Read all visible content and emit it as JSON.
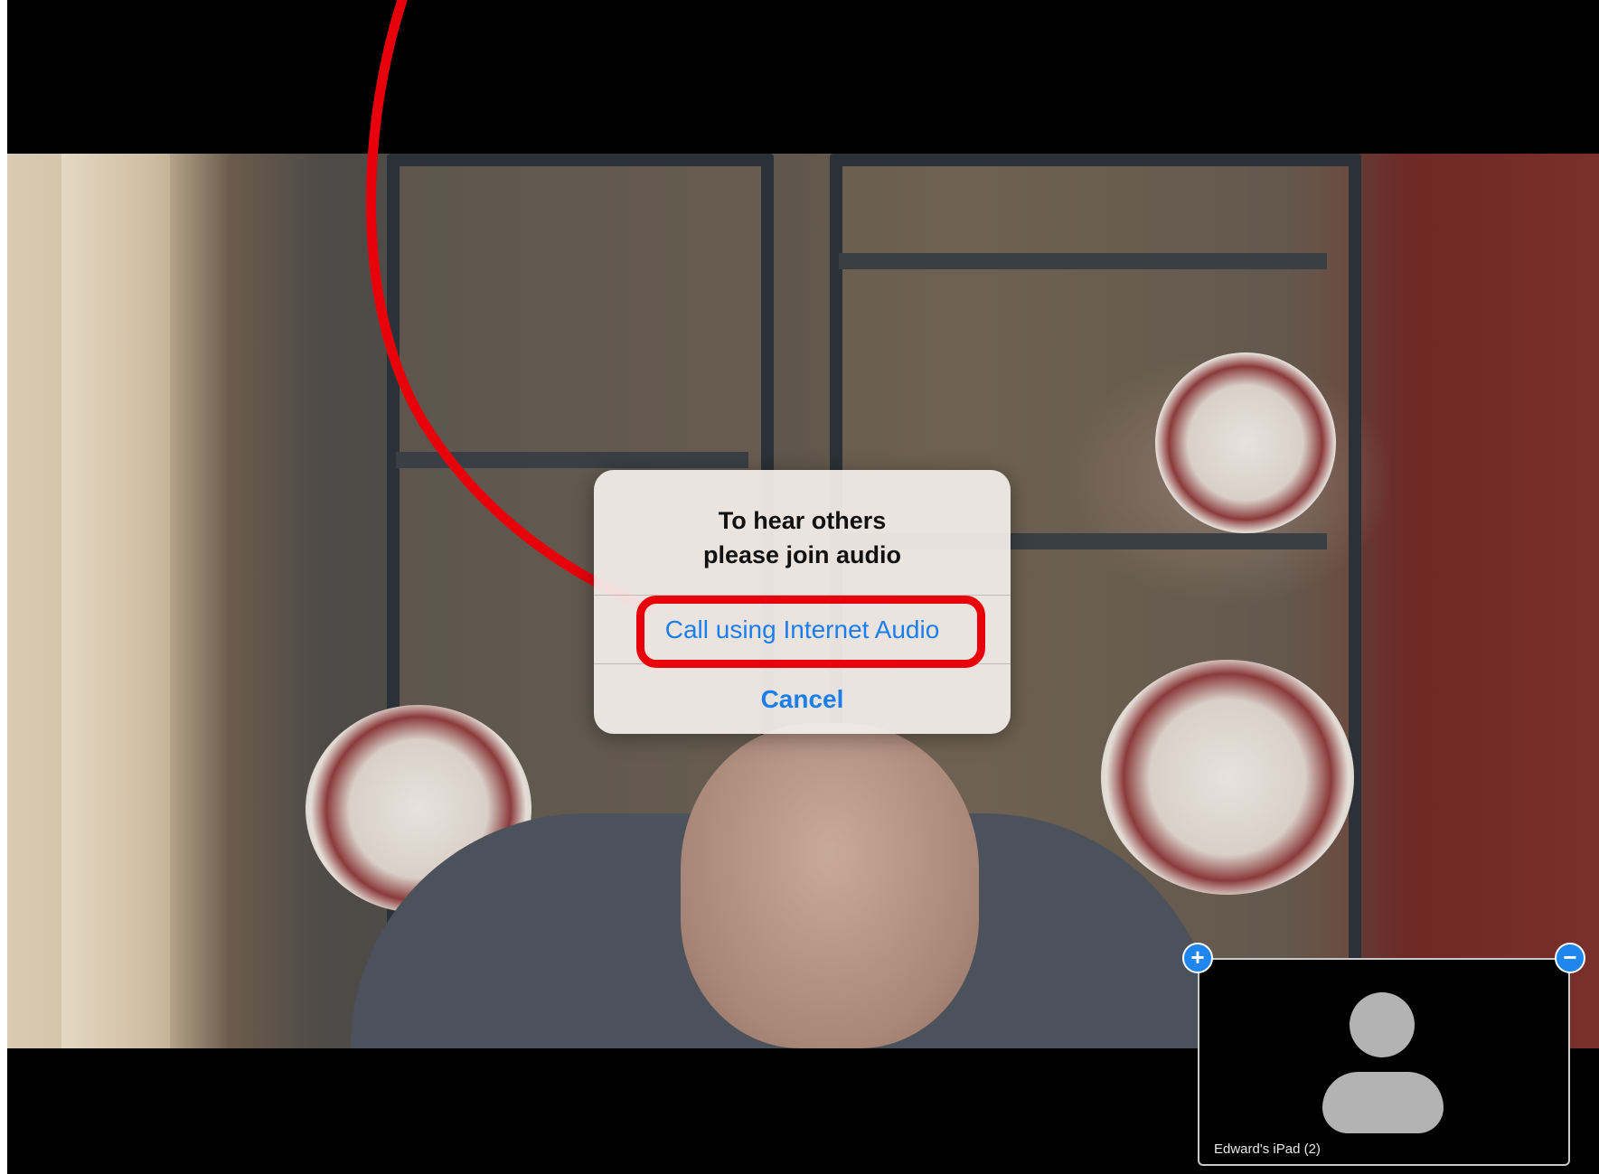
{
  "alert": {
    "message": "To hear others\nplease join audio",
    "primary_button": "Call using Internet Audio",
    "cancel_button": "Cancel"
  },
  "thumbnail": {
    "label": "Edward's iPad (2)",
    "expand_icon": "plus-icon",
    "collapse_icon": "minus-icon"
  },
  "colors": {
    "alert_link": "#1a7ef0",
    "annotation": "#e8000b",
    "thumbnail_control": "#1f86f0"
  }
}
